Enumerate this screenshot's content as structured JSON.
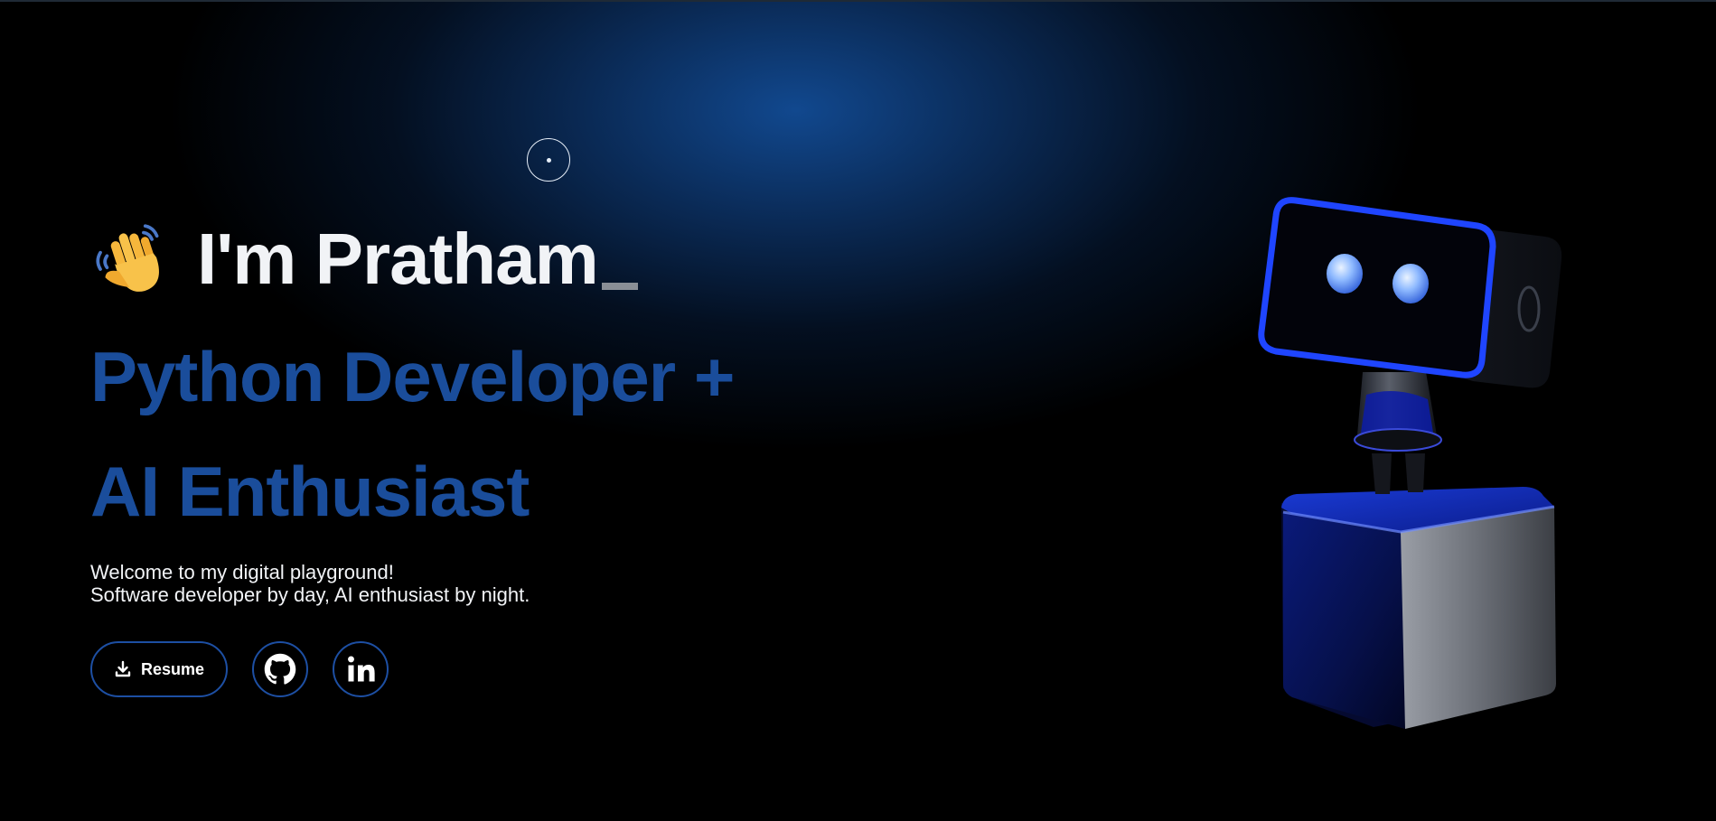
{
  "hero": {
    "wave_emoji": "👋",
    "greeting": "I'm Pratham",
    "headline_line1": "Python Developer +",
    "headline_line2": "AI Enthusiast",
    "intro_line1": "Welcome to my digital playground!",
    "intro_line2": "Software developer by day, AI enthusiast by night."
  },
  "actions": {
    "resume_label": "Resume",
    "resume_icon": "download-icon",
    "github_icon": "github-icon",
    "linkedin_icon": "linkedin-icon"
  },
  "colors": {
    "background": "#000000",
    "accent": "#1a4d9b",
    "button_border": "#1d4fa3",
    "glow": "#124c96",
    "text": "#f1f3f6"
  }
}
